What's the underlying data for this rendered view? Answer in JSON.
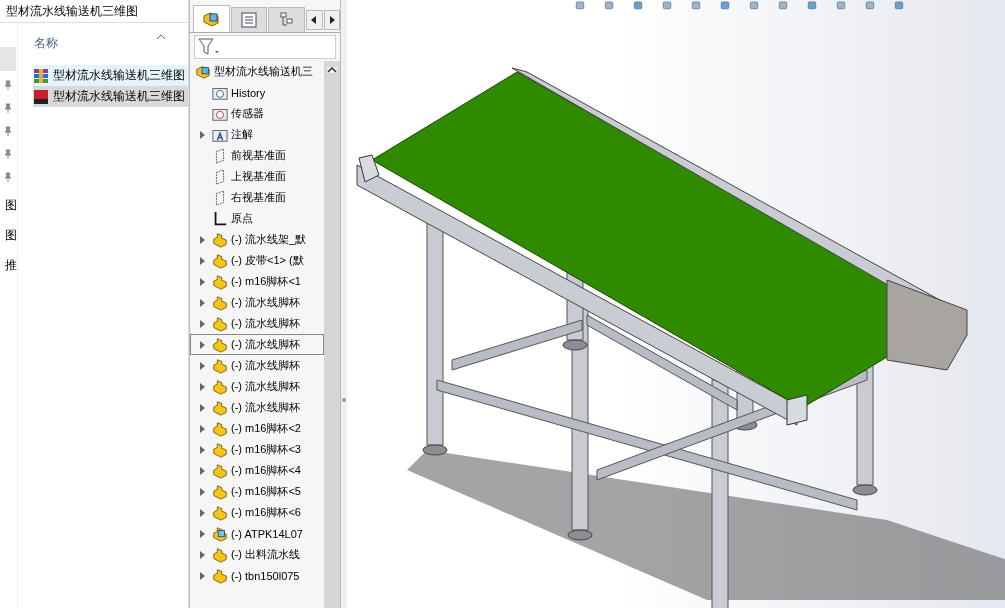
{
  "explorer": {
    "path": "型材流水线输送机三维图",
    "nav_labels": [
      "图",
      "图",
      "推"
    ],
    "column_header": "名称",
    "files": [
      {
        "name": "型材流水线输送机三维图",
        "kind": "archive",
        "selected": false
      },
      {
        "name": "型材流水线输送机三维图",
        "kind": "solidworks",
        "selected": true
      }
    ]
  },
  "feature_tree": {
    "tabs": [
      {
        "kind": "feature",
        "selected": true
      },
      {
        "kind": "property",
        "selected": false
      },
      {
        "kind": "config",
        "selected": false
      }
    ],
    "root": "型材流水线输送机三",
    "items": [
      {
        "label": "History",
        "kind": "history",
        "expandable": false,
        "selected": false
      },
      {
        "label": "传感器",
        "kind": "sensor",
        "expandable": false,
        "selected": false
      },
      {
        "label": "注解",
        "kind": "annotation",
        "expandable": true,
        "selected": false
      },
      {
        "label": "前视基准面",
        "kind": "plane",
        "expandable": false,
        "selected": false
      },
      {
        "label": "上视基准面",
        "kind": "plane",
        "expandable": false,
        "selected": false
      },
      {
        "label": "右视基准面",
        "kind": "plane",
        "expandable": false,
        "selected": false
      },
      {
        "label": "原点",
        "kind": "origin",
        "expandable": false,
        "selected": false
      },
      {
        "label": "(-) 流水线架_默",
        "kind": "assembly",
        "expandable": true,
        "selected": false
      },
      {
        "label": "(-) 皮带<1> (默",
        "kind": "assembly",
        "expandable": true,
        "selected": false
      },
      {
        "label": "(-) m16脚杯<1",
        "kind": "assembly",
        "expandable": true,
        "selected": false
      },
      {
        "label": "(-) 流水线脚杯",
        "kind": "assembly",
        "expandable": true,
        "selected": false
      },
      {
        "label": "(-) 流水线脚杯",
        "kind": "assembly",
        "expandable": true,
        "selected": false
      },
      {
        "label": "(-) 流水线脚杯",
        "kind": "assembly",
        "expandable": true,
        "selected": true
      },
      {
        "label": "(-) 流水线脚杯",
        "kind": "assembly",
        "expandable": true,
        "selected": false
      },
      {
        "label": "(-) 流水线脚杯",
        "kind": "assembly",
        "expandable": true,
        "selected": false
      },
      {
        "label": "(-) 流水线脚杯",
        "kind": "assembly",
        "expandable": true,
        "selected": false
      },
      {
        "label": "(-) m16脚杯<2",
        "kind": "assembly",
        "expandable": true,
        "selected": false
      },
      {
        "label": "(-) m16脚杯<3",
        "kind": "assembly",
        "expandable": true,
        "selected": false
      },
      {
        "label": "(-) m16脚杯<4",
        "kind": "assembly",
        "expandable": true,
        "selected": false
      },
      {
        "label": "(-) m16脚杯<5",
        "kind": "assembly",
        "expandable": true,
        "selected": false
      },
      {
        "label": "(-) m16脚杯<6",
        "kind": "assembly",
        "expandable": true,
        "selected": false
      },
      {
        "label": "(-) ATPK14L07",
        "kind": "part",
        "expandable": true,
        "selected": false
      },
      {
        "label": "(-) 出料流水线",
        "kind": "assembly",
        "expandable": true,
        "selected": false
      },
      {
        "label": "(-) tbn150l075",
        "kind": "assembly",
        "expandable": true,
        "selected": false
      }
    ]
  }
}
